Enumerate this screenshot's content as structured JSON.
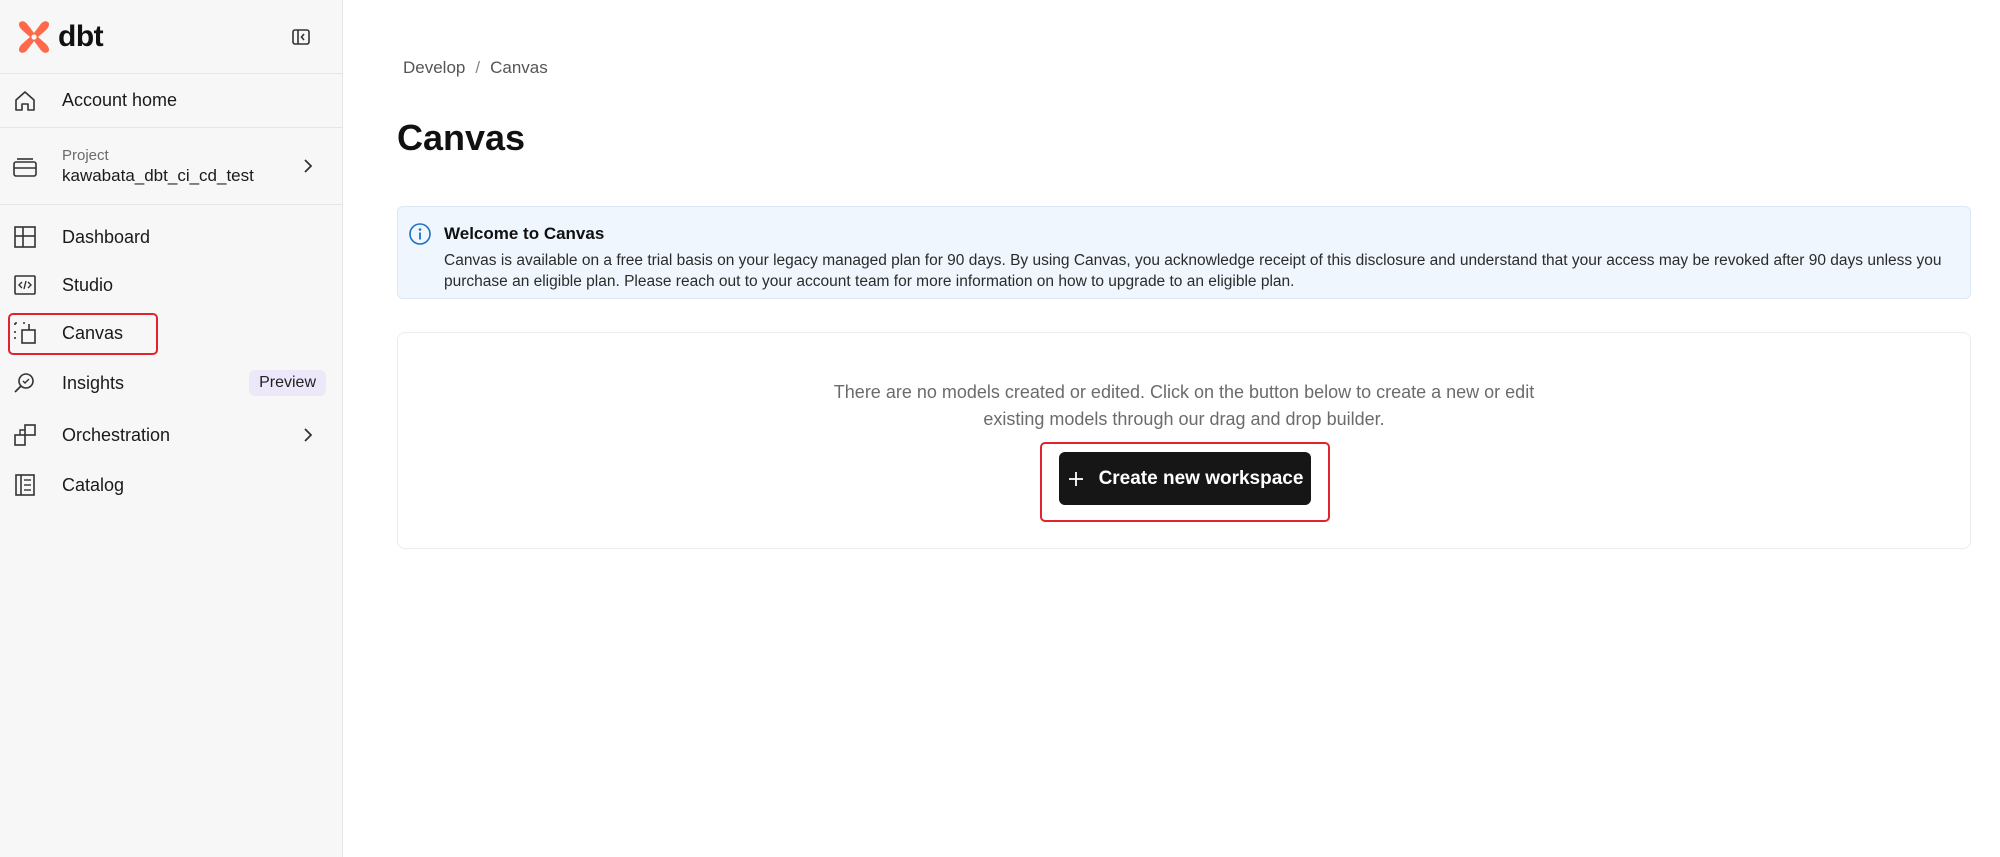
{
  "brand": {
    "name": "dbt",
    "accent": "#ff694a"
  },
  "sidebar": {
    "account_home": "Account home",
    "project": {
      "caption": "Project",
      "name": "kawabata_dbt_ci_cd_test"
    },
    "items": [
      {
        "label": "Dashboard",
        "icon": "dashboard-icon"
      },
      {
        "label": "Studio",
        "icon": "code-icon"
      },
      {
        "label": "Canvas",
        "icon": "canvas-icon",
        "active": true
      },
      {
        "label": "Insights",
        "icon": "insights-icon",
        "badge": "Preview"
      },
      {
        "label": "Orchestration",
        "icon": "orchestration-icon",
        "has_children": true
      },
      {
        "label": "Catalog",
        "icon": "catalog-icon"
      }
    ]
  },
  "breadcrumb": {
    "parent": "Develop",
    "separator": "/",
    "current": "Canvas"
  },
  "page": {
    "title": "Canvas"
  },
  "banner": {
    "title": "Welcome to Canvas",
    "body": "Canvas is available on a free trial basis on your legacy managed plan for 90 days. By using Canvas, you acknowledge receipt of this disclosure and understand that your access may be revoked after 90 days unless you purchase an eligible plan. Please reach out to your account team for more information on how to upgrade to an eligible plan."
  },
  "empty_state": {
    "line1": "There are no models created or edited. Click on the button below to create a new or edit",
    "line2": "existing models through our drag and drop builder.",
    "cta_label": "Create new workspace"
  },
  "colors": {
    "highlight": "#e0242e",
    "banner_bg": "#eff6fd",
    "cta_bg": "#161616",
    "info_blue": "#1f6fc5"
  }
}
